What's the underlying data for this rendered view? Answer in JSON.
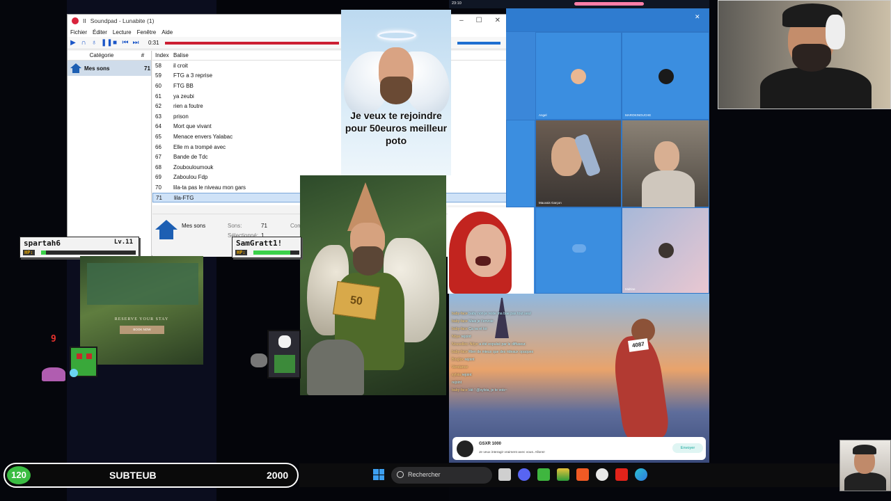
{
  "soundpad": {
    "title": "Soundpad - Lunabite (1)",
    "title_prefix": "II",
    "menu": [
      "Fichier",
      "Éditer",
      "Lecture",
      "Fenêtre",
      "Aide"
    ],
    "time": "0:31",
    "left_headers": {
      "category": "Catégorie",
      "count": "#"
    },
    "category": {
      "name": "Mes sons",
      "count": "71"
    },
    "list_headers": {
      "index": "Index",
      "tag": "Balise"
    },
    "sounds": [
      {
        "index": "58",
        "tag": "il croit"
      },
      {
        "index": "59",
        "tag": "FTG a 3 reprise"
      },
      {
        "index": "60",
        "tag": "FTG BB"
      },
      {
        "index": "61",
        "tag": "ya zeubi"
      },
      {
        "index": "62",
        "tag": "rien a foutre"
      },
      {
        "index": "63",
        "tag": "prison"
      },
      {
        "index": "64",
        "tag": "Mort que vivant"
      },
      {
        "index": "65",
        "tag": "Menace envers Yalabac"
      },
      {
        "index": "66",
        "tag": "Elle m a trompé avec"
      },
      {
        "index": "67",
        "tag": "Bande de Tdc"
      },
      {
        "index": "68",
        "tag": "Zoubouloumouk"
      },
      {
        "index": "69",
        "tag": "Zaboulou Fdp"
      },
      {
        "index": "70",
        "tag": "lila-ta pas le niveau mon gars"
      },
      {
        "index": "71",
        "tag": "lila-FTG"
      }
    ],
    "selected_index": "71",
    "footer": {
      "name": "Mes sons",
      "sons_label": "Sons:",
      "sons_value": "71",
      "selected_label": "Sélectionné:",
      "selected_value": "1",
      "com_label": "Com"
    }
  },
  "angel_meme": {
    "text": "Je veux te rejoindre pour 50euros meilleur poto"
  },
  "elf_meme": {
    "note": "50"
  },
  "phone": {
    "clock": "23:10"
  },
  "discord": {
    "tiles": [
      {
        "name": "Angel"
      },
      {
        "name": "MAROKINOUCHE"
      },
      {
        "name": ""
      },
      {
        "name": "Mauvais Garçon"
      },
      {
        "name": ""
      },
      {
        "name": ""
      },
      {
        "name": "Maltine"
      }
    ]
  },
  "chat": {
    "lines": [
      {
        "user": "baby-face",
        "msg": "baby non je reste ma bae pas tout seul"
      },
      {
        "user": "baby-face",
        "msg": "Mais je t'envoie"
      },
      {
        "user": "baby-face",
        "msg": "Ça va et toi"
      },
      {
        "user": "Nöye",
        "msg": "rejoint"
      },
      {
        "user": "Nouvelles: Nöye",
        "msg": "a été expulsé par le diffuseur."
      },
      {
        "user": "baby-face",
        "msg": "Rien de mieux que des rideaux opaques"
      },
      {
        "user": "Boujlox",
        "msg": "rejoint"
      },
      {
        "user": "Verstance",
        "msg": ""
      },
      {
        "user": "sylvia",
        "msg": "rejoint"
      },
      {
        "user": "",
        "msg": "rejoint"
      },
      {
        "user": "baby-face",
        "msg": "Hé ! @sylvia, je te vois~"
      }
    ],
    "notification": {
      "title": "GSXR 1000",
      "subtitle": "Je veux interagir vraiment avec vous. Allons!",
      "button": "Envoyer"
    },
    "bib": "4087"
  },
  "game": {
    "players": [
      {
        "name": "spartah6",
        "level": "Lv.11",
        "hp_label": "HP:",
        "hp_fraction": 0.05
      },
      {
        "name": "SamGratt1!",
        "level": "",
        "hp_label": "HP:",
        "hp_fraction": 0.8
      }
    ],
    "damage": "9",
    "ad": {
      "title": "RESERVE YOUR STAY",
      "button": "BOOK NOW"
    }
  },
  "scorebar": {
    "level": "120",
    "name": "SUBTEUB",
    "score": "2000"
  },
  "taskbar": {
    "search_placeholder": "Rechercher"
  },
  "colors": {
    "soundpad_accent": "#cc1f33",
    "discord_bg": "#3b87d9",
    "hp_green": "#3bd14a",
    "level_green": "#3bbd43"
  }
}
